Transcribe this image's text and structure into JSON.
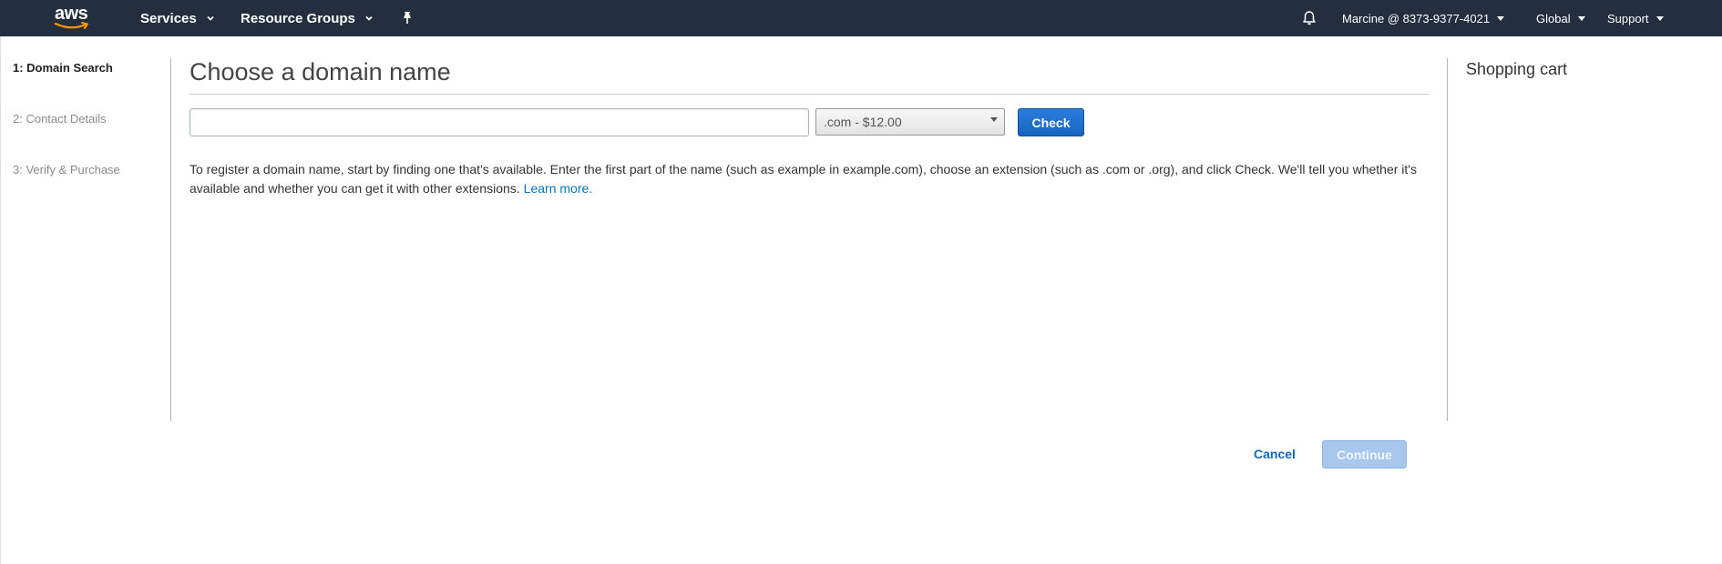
{
  "nav": {
    "logo_text": "aws",
    "services_label": "Services",
    "resource_groups_label": "Resource Groups",
    "pin_icon": "pin-icon",
    "bell_icon": "bell-icon",
    "account_label": "Marcine @ 8373-9377-4021",
    "region_label": "Global",
    "support_label": "Support",
    "bg_color": "#232f3e"
  },
  "steps": [
    {
      "label": "1: Domain Search",
      "active": true
    },
    {
      "label": "2: Contact Details",
      "active": false
    },
    {
      "label": "3: Verify & Purchase",
      "active": false
    }
  ],
  "main": {
    "title": "Choose a domain name",
    "domain_input_value": "",
    "tld_selected": ".com - $12.00",
    "check_label": "Check",
    "description": "To register a domain name, start by finding one that's available. Enter the first part of the name (such as example in example.com), choose an extension (such as .com or .org), and click Check. We'll tell you whether it's available and whether you can get it with other extensions.",
    "learn_more_label": "Learn more."
  },
  "cart": {
    "title": "Shopping cart"
  },
  "footer": {
    "cancel_label": "Cancel",
    "continue_label": "Continue"
  },
  "colors": {
    "accent": "#1565c0",
    "link": "#0073bb",
    "disabled_button": "#a7c8ec"
  }
}
